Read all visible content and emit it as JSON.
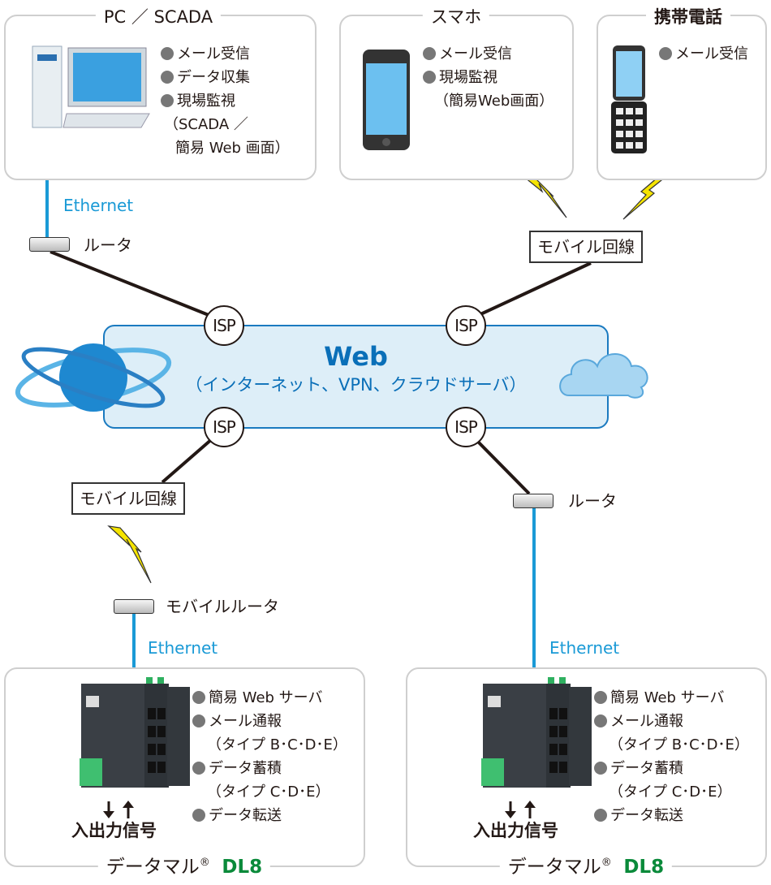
{
  "pc": {
    "title": "PC ／ SCADA",
    "features": [
      "メール受信",
      "データ収集",
      "現場監視"
    ],
    "sub": [
      "（SCADA ／",
      "簡易 Web 画面）"
    ],
    "icon": "desktop-pc-icon"
  },
  "smartphone": {
    "title": "スマホ",
    "features": [
      "メール受信",
      "現場監視"
    ],
    "sub": [
      "（簡易Web画面）"
    ],
    "icon": "smartphone-icon"
  },
  "mobile_phone": {
    "title": "携帯電話",
    "features": [
      "メール受信"
    ],
    "icon": "flip-phone-icon"
  },
  "links": {
    "ethernet": "Ethernet",
    "router": "ルータ",
    "mobile_line": "モバイル回線",
    "mobile_router": "モバイルルータ",
    "isp": "ISP"
  },
  "web": {
    "title": "Web",
    "subtitle": "（インターネット、VPN、クラウドサーバ）",
    "icons": [
      "globe-icon",
      "cloud-icon"
    ]
  },
  "dl8": {
    "name": "データマル",
    "reg": "®",
    "model": "DL8",
    "io_label": "入出力信号",
    "features": [
      "簡易 Web サーバ",
      "メール通報",
      "データ蓄積",
      "データ転送"
    ],
    "sub": [
      "（タイプ B･C･D･E）",
      "（タイプ C･D･E）"
    ]
  },
  "colors": {
    "ethernet": "#1a9ad6",
    "web_fill": "#ddeef8",
    "web_border": "#1a7ac0",
    "web_text": "#0a6fb8",
    "dl8": "#0a8a3a",
    "lightning": "#f5e400"
  }
}
